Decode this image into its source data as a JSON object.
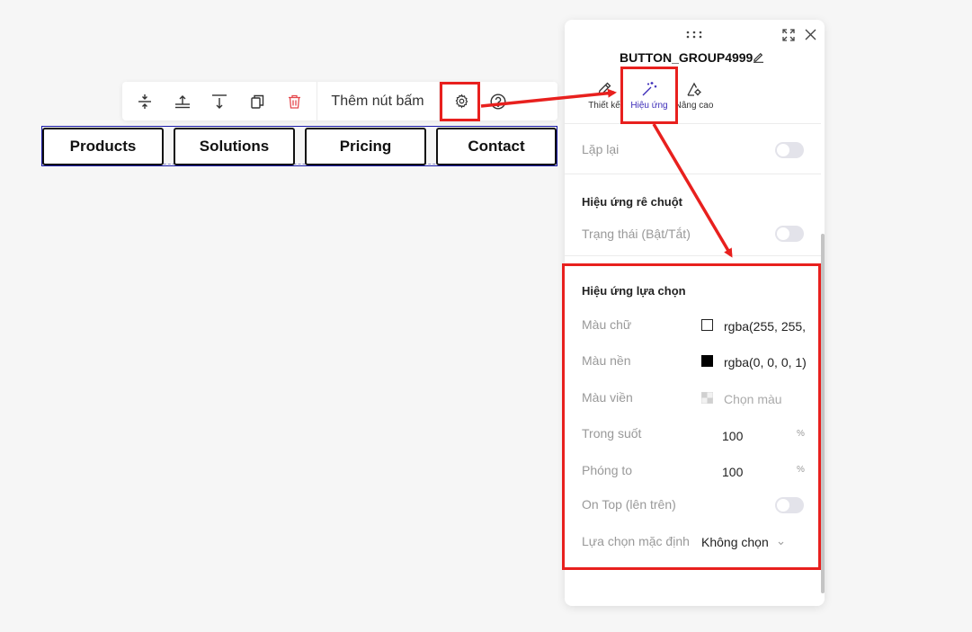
{
  "toolbar": {
    "add_button_label": "Thêm nút bấm",
    "icons": [
      "align-vertical-center-icon",
      "move-up-icon",
      "move-down-icon",
      "duplicate-icon",
      "delete-icon",
      "gear-icon",
      "help-icon"
    ]
  },
  "button_group": {
    "buttons": [
      "Products",
      "Solutions",
      "Pricing",
      "Contact"
    ]
  },
  "panel": {
    "title": "BUTTON_GROUP4999",
    "tabs": [
      {
        "label": "Thiết kế",
        "icon": "pencil-ruler-icon"
      },
      {
        "label": "Hiệu ứng",
        "icon": "magic-wand-icon"
      },
      {
        "label": "Nâng cao",
        "icon": "advanced-settings-icon"
      }
    ],
    "repeat_label": "Lặp lại",
    "hover_section_title": "Hiệu ứng rê chuột",
    "hover_state_label": "Trạng thái (Bật/Tắt)",
    "select_section_title": "Hiệu ứng lựa chọn",
    "text_color_label": "Màu chữ",
    "text_color_value": "rgba(255, 255,",
    "bg_color_label": "Màu nền",
    "bg_color_value": "rgba(0, 0, 0, 1)",
    "border_color_label": "Màu viền",
    "border_color_placeholder": "Chọn màu",
    "opacity_label": "Trong suốt",
    "opacity_value": "100",
    "opacity_unit": "%",
    "zoom_label": "Phóng to",
    "zoom_value": "100",
    "zoom_unit": "%",
    "on_top_label": "On Top (lên trên)",
    "default_select_label": "Lựa chọn mặc định",
    "default_select_value": "Không chọn"
  },
  "colors": {
    "accent": "#3b2bb8",
    "annotation_red": "#e8201e",
    "delete_red": "#e5484d"
  }
}
